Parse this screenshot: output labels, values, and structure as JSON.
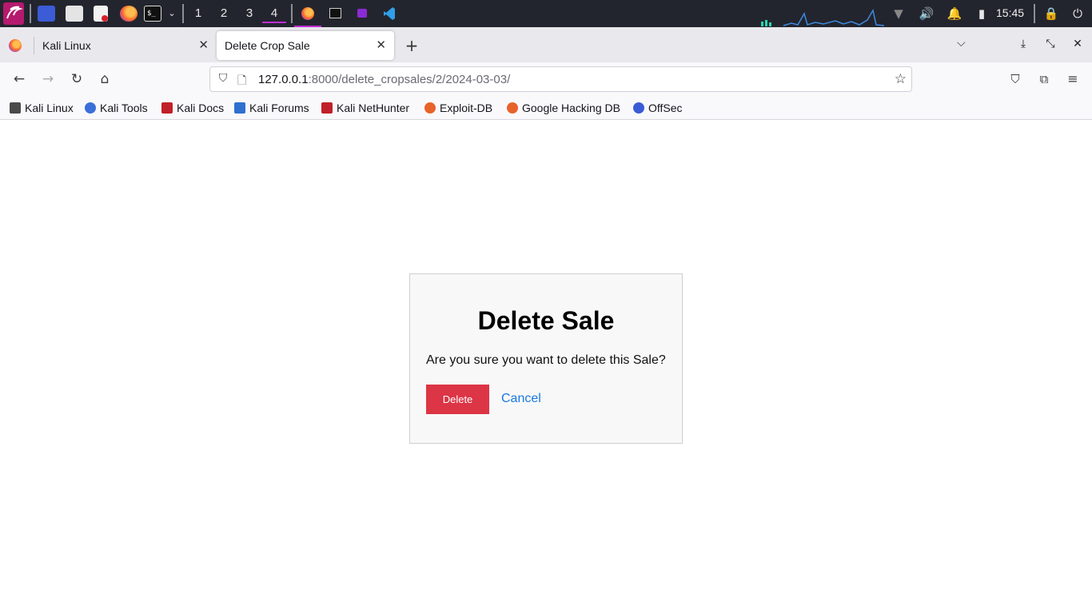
{
  "panel": {
    "workspaces": [
      "1",
      "2",
      "3",
      "4"
    ],
    "active_workspace": "4",
    "clock": "15:45",
    "icons": [
      "kali-dragon-icon",
      "desktop-icon",
      "file-manager-icon",
      "text-editor-icon",
      "firefox-icon",
      "terminal-icon",
      "chevron-down-icon",
      "firefox-window-icon",
      "terminal-window-icon",
      "app-window-icon",
      "vscode-icon",
      "network-icon",
      "volume-icon",
      "notification-bell-icon",
      "battery-icon",
      "lock-icon",
      "power-icon"
    ],
    "colors": {
      "bg": "#23252e",
      "accent": "#c22bd3"
    }
  },
  "tabs": [
    {
      "label": "Kali Linux",
      "active": false
    },
    {
      "label": "Delete Crop Sale",
      "active": true
    }
  ],
  "nav": {
    "url_host": "127.0.0.1",
    "url_rest": ":8000/delete_cropsales/2/2024-03-03/"
  },
  "bookmarks": [
    {
      "label": "Kali Linux",
      "color": "#3a3a3a"
    },
    {
      "label": "Kali Tools",
      "color": "#3a6fd8"
    },
    {
      "label": "Kali Docs",
      "color": "#c0202a"
    },
    {
      "label": "Kali Forums",
      "color": "#2f6fd0"
    },
    {
      "label": "Kali NetHunter",
      "color": "#c0202a"
    },
    {
      "label": "Exploit-DB",
      "color": "#e8632a"
    },
    {
      "label": "Google Hacking DB",
      "color": "#e8632a"
    },
    {
      "label": "OffSec",
      "color": "#3b5bd6"
    }
  ],
  "dialog": {
    "title": "Delete Sale",
    "message": "Are you sure you want to delete this Sale?",
    "delete_label": "Delete",
    "cancel_label": "Cancel",
    "colors": {
      "danger": "#dc3545",
      "link": "#1a7ae0"
    }
  }
}
